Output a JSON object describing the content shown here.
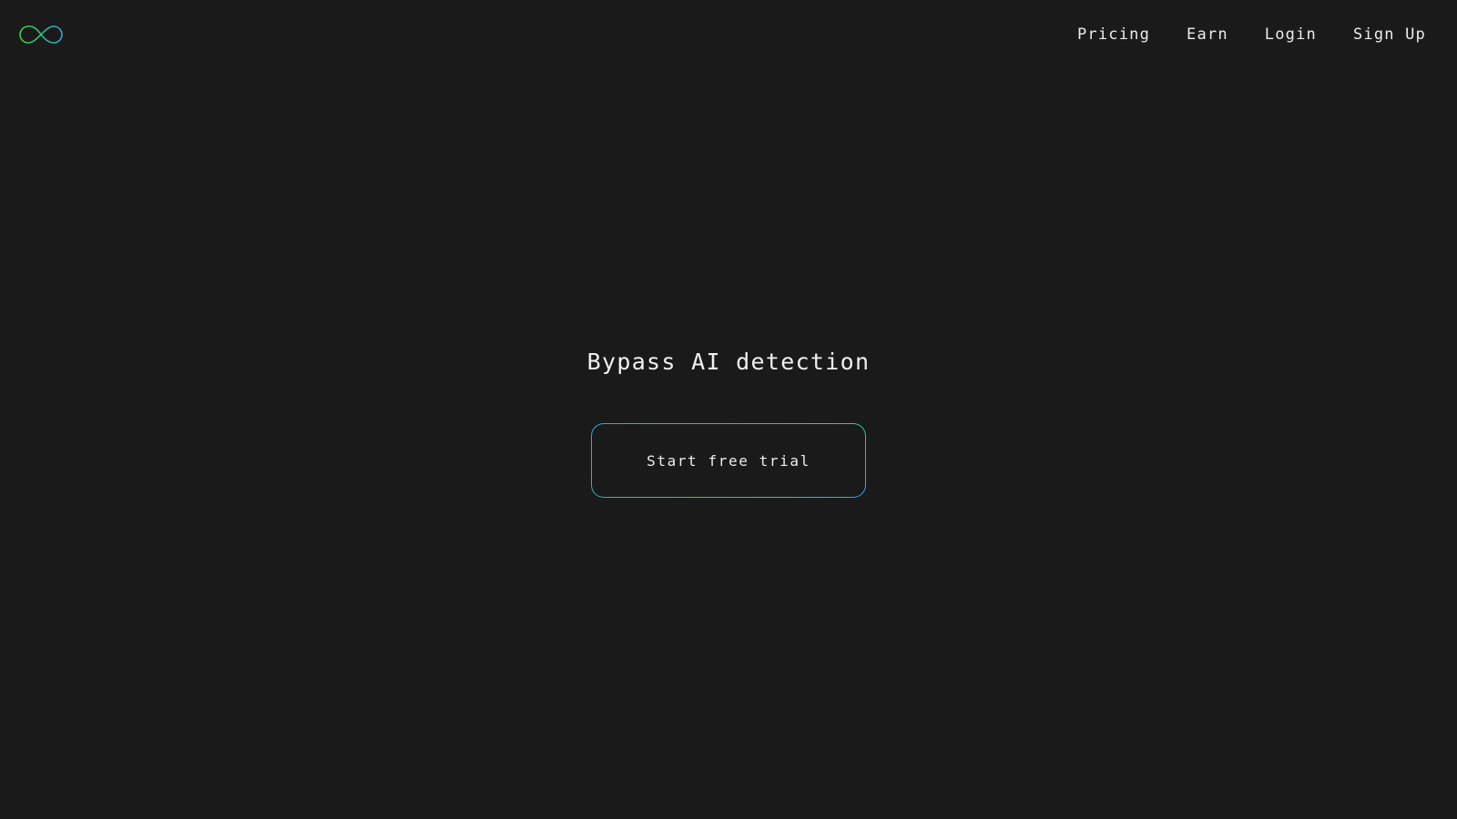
{
  "logo": {
    "icon": "infinity-icon",
    "colors": {
      "left": "#37cd49",
      "right": "#25a9e6"
    }
  },
  "nav": {
    "items": [
      {
        "label": "Pricing"
      },
      {
        "label": "Earn"
      },
      {
        "label": "Login"
      },
      {
        "label": "Sign Up"
      }
    ]
  },
  "hero": {
    "title": "Bypass AI detection",
    "cta_label": "Start free trial"
  },
  "colors": {
    "background": "#1a1a1a",
    "text": "#ececec",
    "accent_green": "#37cd49",
    "accent_blue": "#25a9e6"
  }
}
